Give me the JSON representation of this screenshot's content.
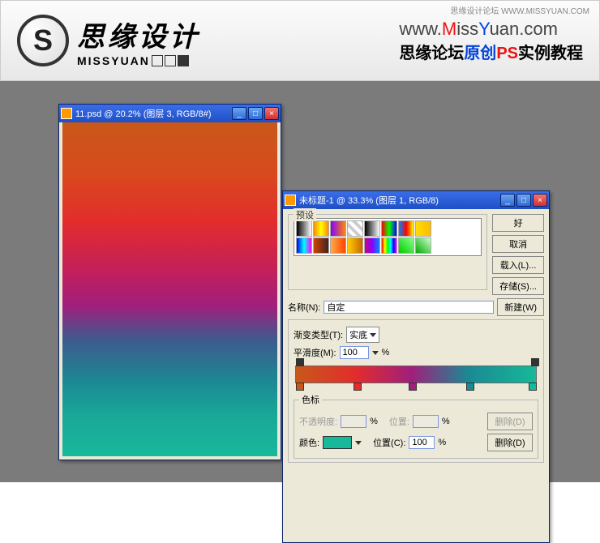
{
  "banner": {
    "corner": "思缘设计论坛  WWW.MISSYUAN.COM",
    "logo_letter": "S",
    "logo_cn": "思缘设计",
    "logo_en": "MISSYUAN",
    "url_prefix": "www.",
    "url_m": "M",
    "url_mid1": "iss",
    "url_y": "Y",
    "url_mid2": "uan.com",
    "subtitle_p1": "思缘论坛",
    "subtitle_p2": "原创",
    "subtitle_p3": "PS",
    "subtitle_p4": "实例教程"
  },
  "win1": {
    "title": "11.psd @ 20.2% (图层 3, RGB/8#)"
  },
  "win2": {
    "title": "未标题-1 @ 33.3% (图层 1, RGB/8)",
    "presets_label": "预设",
    "btn_ok": "好",
    "btn_cancel": "取消",
    "btn_load": "载入(L)...",
    "btn_save": "存储(S)...",
    "name_label": "名称(N):",
    "name_value": "自定",
    "btn_new": "新建(W)",
    "type_label": "渐变类型(T):",
    "type_value": "实底",
    "smooth_label": "平滑度(M):",
    "smooth_value": "100",
    "percent": "%",
    "stops_label": "色标",
    "opacity_label": "不透明度:",
    "opacity_value": "",
    "pos1_label": "位置:",
    "pos1_value": "",
    "btn_del1": "删除(D)",
    "color_label": "颜色:",
    "pos2_label": "位置(C):",
    "pos2_value": "100",
    "btn_del2": "删除(D)"
  },
  "swatches": [
    "linear-gradient(to right,#000,#fff)",
    "linear-gradient(to right,#f80,#ff0,#f80)",
    "linear-gradient(to right,#80f,#f80)",
    "repeating-linear-gradient(45deg,#ccc 0 4px,#fff 4px 8px)",
    "linear-gradient(to right,#000,#fff)",
    "linear-gradient(to right,#f00,#0f0,#00f)",
    "linear-gradient(to right,#08f,#f00,#ff0)",
    "linear-gradient(to right,#fd0,#fb0)",
    "linear-gradient(to right,#00f,#0ff,#f0f)",
    "linear-gradient(to right,#c40,#422)",
    "linear-gradient(to right,#fa4,#f40)",
    "linear-gradient(to right,#fc0,#c60)",
    "linear-gradient(to right,#c08,#80f,#08f)",
    "linear-gradient(to right,#f00,#ff0,#0f0,#0ff,#00f,#f0f)",
    "linear-gradient(45deg,#0c0,#8f8)",
    "linear-gradient(45deg,#0a0,#cfc)"
  ],
  "chart_data": {
    "type": "gradient",
    "stops": [
      {
        "pos": 0,
        "color": "#c8581a"
      },
      {
        "pos": 25,
        "color": "#e22c2c"
      },
      {
        "pos": 48,
        "color": "#a01f7c"
      },
      {
        "pos": 72,
        "color": "#1a8a93"
      },
      {
        "pos": 100,
        "color": "#18b89a"
      }
    ]
  }
}
